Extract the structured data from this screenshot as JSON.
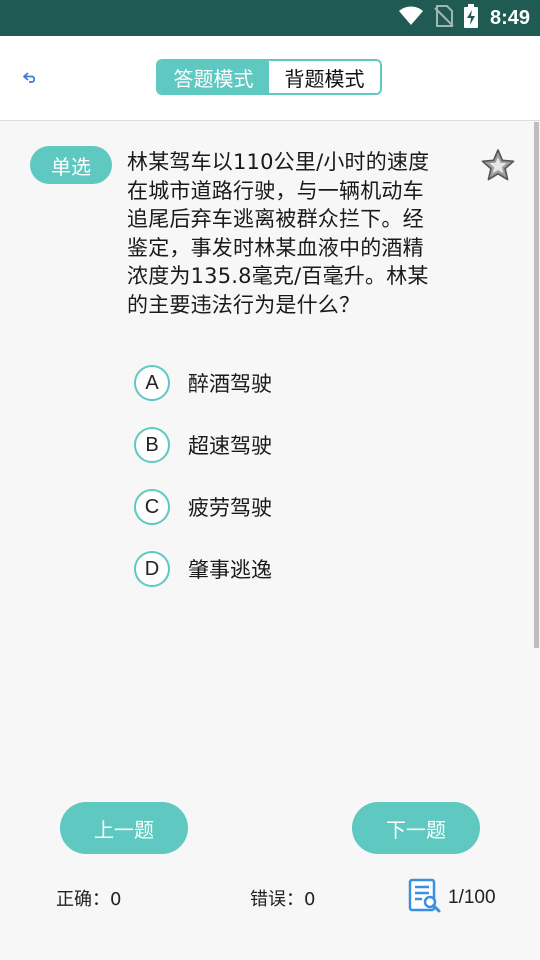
{
  "status_bar": {
    "time": "8:49",
    "icons": [
      "wifi-icon",
      "no-sim-icon",
      "battery-charging-icon"
    ]
  },
  "header": {
    "back_icon": "back-arrow-icon",
    "modes": [
      {
        "label": "答题模式",
        "active": true
      },
      {
        "label": "背题模式",
        "active": false
      }
    ]
  },
  "question": {
    "type": "单选",
    "lines": [
      "林某驾车以110公里/小时的速度",
      "在城市道路行驶，与一辆机动车",
      "追尾后弃车逃离被群众拦下。经",
      "鉴定，事发时林某血液中的酒精",
      "浓度为135.8毫克/百毫升。林某",
      "的主要违法行为是什么？"
    ],
    "favorite_icon": "star-icon",
    "options": [
      {
        "letter": "A",
        "text": "醉酒驾驶"
      },
      {
        "letter": "B",
        "text": "超速驾驶"
      },
      {
        "letter": "C",
        "text": "疲劳驾驶"
      },
      {
        "letter": "D",
        "text": "肇事逃逸"
      }
    ]
  },
  "navigation": {
    "prev_label": "上一题",
    "next_label": "下一题"
  },
  "footer": {
    "correct_label": "正确：",
    "correct_count": "0",
    "wrong_label": "错误：",
    "wrong_count": "0",
    "progress_icon": "answer-sheet-icon",
    "progress": "1/100"
  },
  "colors": {
    "accent": "#5ec8c1",
    "status_bar": "#1f5b52"
  }
}
